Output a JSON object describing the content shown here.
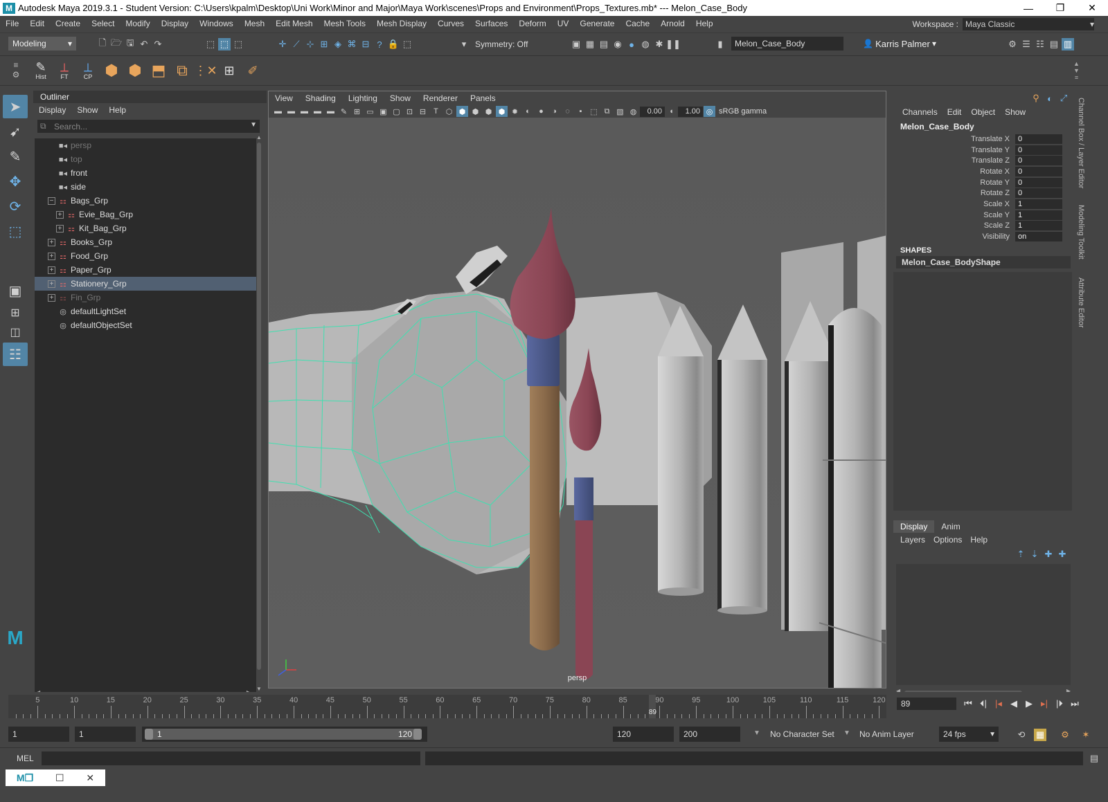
{
  "window": {
    "title": "Autodesk Maya 2019.3.1 - Student Version: C:\\Users\\kpalm\\Desktop\\Uni Work\\Minor and Major\\Maya Work\\scenes\\Props and Environment\\Props_Textures.mb*   ---   Melon_Case_Body",
    "logo": "M",
    "controls": [
      "—",
      "❐",
      "✕"
    ]
  },
  "menubar": {
    "items": [
      "File",
      "Edit",
      "Create",
      "Select",
      "Modify",
      "Display",
      "Windows",
      "Mesh",
      "Edit Mesh",
      "Mesh Tools",
      "Mesh Display",
      "Curves",
      "Surfaces",
      "Deform",
      "UV",
      "Generate",
      "Cache",
      "Arnold",
      "Help"
    ],
    "workspace_label": "Workspace :",
    "workspace_value": "Maya Classic"
  },
  "statusline": {
    "mode": "Modeling",
    "symmetry": "Symmetry: Off",
    "object_field": "Melon_Case_Body",
    "user": "Karris Palmer"
  },
  "shelf": {
    "hist": "Hist",
    "ft": "FT",
    "cp": "CP"
  },
  "outliner": {
    "title": "Outliner",
    "menu": [
      "Display",
      "Show",
      "Help"
    ],
    "search_placeholder": "Search...",
    "nodes": [
      {
        "label": "persp",
        "dim": true
      },
      {
        "label": "top",
        "dim": true
      },
      {
        "label": "front",
        "dim": false
      },
      {
        "label": "side",
        "dim": false
      },
      {
        "label": "Bags_Grp"
      },
      {
        "label": "Evie_Bag_Grp"
      },
      {
        "label": "Kit_Bag_Grp"
      },
      {
        "label": "Books_Grp"
      },
      {
        "label": "Food_Grp"
      },
      {
        "label": "Paper_Grp"
      },
      {
        "label": "Stationery_Grp"
      },
      {
        "label": "Fin_Grp"
      },
      {
        "label": "defaultLightSet"
      },
      {
        "label": "defaultObjectSet"
      }
    ]
  },
  "viewport": {
    "menu": [
      "View",
      "Shading",
      "Lighting",
      "Show",
      "Renderer",
      "Panels"
    ],
    "exposure": "0.00",
    "gamma": "1.00",
    "colorspace": "sRGB gamma",
    "camera": "persp"
  },
  "channelbox": {
    "menu": [
      "Channels",
      "Edit",
      "Object",
      "Show"
    ],
    "object": "Melon_Case_Body",
    "attributes": [
      {
        "name": "Translate X",
        "value": "0"
      },
      {
        "name": "Translate Y",
        "value": "0"
      },
      {
        "name": "Translate Z",
        "value": "0"
      },
      {
        "name": "Rotate X",
        "value": "0"
      },
      {
        "name": "Rotate Y",
        "value": "0"
      },
      {
        "name": "Rotate Z",
        "value": "0"
      },
      {
        "name": "Scale X",
        "value": "1"
      },
      {
        "name": "Scale Y",
        "value": "1"
      },
      {
        "name": "Scale Z",
        "value": "1"
      },
      {
        "name": "Visibility",
        "value": "on"
      }
    ],
    "shapes_header": "SHAPES",
    "shape": "Melon_Case_BodyShape"
  },
  "sidetabs": [
    "Channel Box / Layer Editor",
    "Modeling Toolkit",
    "Attribute Editor"
  ],
  "layereditor": {
    "tabs": [
      "Display",
      "Anim"
    ],
    "menu": [
      "Layers",
      "Options",
      "Help"
    ]
  },
  "timeslider": {
    "labels": [
      "5",
      "10",
      "15",
      "20",
      "25",
      "30",
      "35",
      "40",
      "45",
      "50",
      "55",
      "60",
      "65",
      "70",
      "75",
      "80",
      "85",
      "90",
      "95",
      "100",
      "105",
      "110",
      "115",
      "120"
    ],
    "current": "89",
    "current_frame_field": "89"
  },
  "range": {
    "start": "1",
    "anim_start": "1",
    "slider_start": "1",
    "slider_end": "120",
    "playback_end": "120",
    "anim_end": "200",
    "character_set": "No Character Set",
    "anim_layer": "No Anim Layer",
    "fps": "24 fps"
  },
  "cmdline": {
    "label": "MEL"
  },
  "colors": {
    "accent": "#5285a6",
    "wire": "#3fe0b0",
    "brush_tip": "#8a4554",
    "brush_ferrule": "#4c5a8c",
    "brush_handle": "#8a6a4a",
    "brush2_handle": "#8a4554"
  }
}
